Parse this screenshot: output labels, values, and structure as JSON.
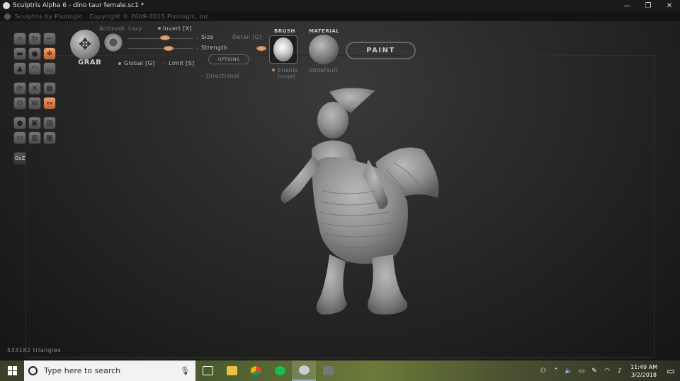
{
  "window": {
    "title": "Sculptris Alpha 6 - dino taur female.sc1 *",
    "minimize": "—",
    "maximize": "❐",
    "close": "✕"
  },
  "subheader": {
    "brand": "Sculptris by Pixologic",
    "copyright": "Copyright © 2009-2015 Pixologic, Inc."
  },
  "tool": {
    "name": "GRAB",
    "airbrush": "Airbrush",
    "lazy": "Lazy",
    "invert": "Invert [X]",
    "global": "Global [G]",
    "limit": "Limit [S]",
    "size": "Size",
    "strength": "Strength",
    "detail": "Detail [Q]",
    "options": "OPTIONS",
    "directional": "Directional"
  },
  "brush": {
    "title": "BRUSH",
    "enable": "Enable",
    "invert": "Invert"
  },
  "material": {
    "title": "MATERIAL",
    "name": "00default"
  },
  "paint_button": "PAINT",
  "goz_button": "GoZ",
  "status": {
    "triangles": "533182 triangles"
  },
  "taskbar": {
    "search_placeholder": "Type here to search",
    "time": "11:49 AM",
    "date": "3/2/2018"
  },
  "colors": {
    "accent": "#d9814d",
    "viewport": "#2b2b2b"
  }
}
